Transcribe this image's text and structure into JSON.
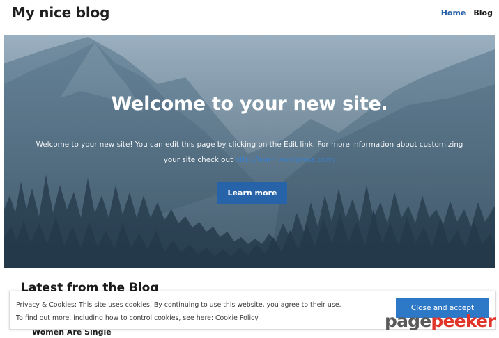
{
  "header": {
    "site_title": "My nice blog",
    "nav": [
      {
        "label": "Home",
        "active": true
      },
      {
        "label": "Blog",
        "active": false
      }
    ]
  },
  "hero": {
    "title": "Welcome to your new site.",
    "text_before": "Welcome to your new site! You can edit this page by clicking on the Edit link. For more information about customizing your site check out ",
    "link_text": "http://learn.wordpress.com/",
    "button_label": "Learn more"
  },
  "latest": {
    "heading": "Latest from the Blog",
    "post_title": "Women Are Single"
  },
  "cookie_banner": {
    "line1": "Privacy & Cookies: This site uses cookies. By continuing to use this website, you agree to their use.",
    "line2_prefix": "To find out more, including how to control cookies, see here: ",
    "policy_link": "Cookie Policy",
    "close_label": "Close and accept"
  },
  "watermark": {
    "part1": "page",
    "part2": "peeker"
  },
  "colors": {
    "accent": "#2763a9",
    "nav_active": "#2a62a8",
    "watermark_red": "#e2352a"
  }
}
